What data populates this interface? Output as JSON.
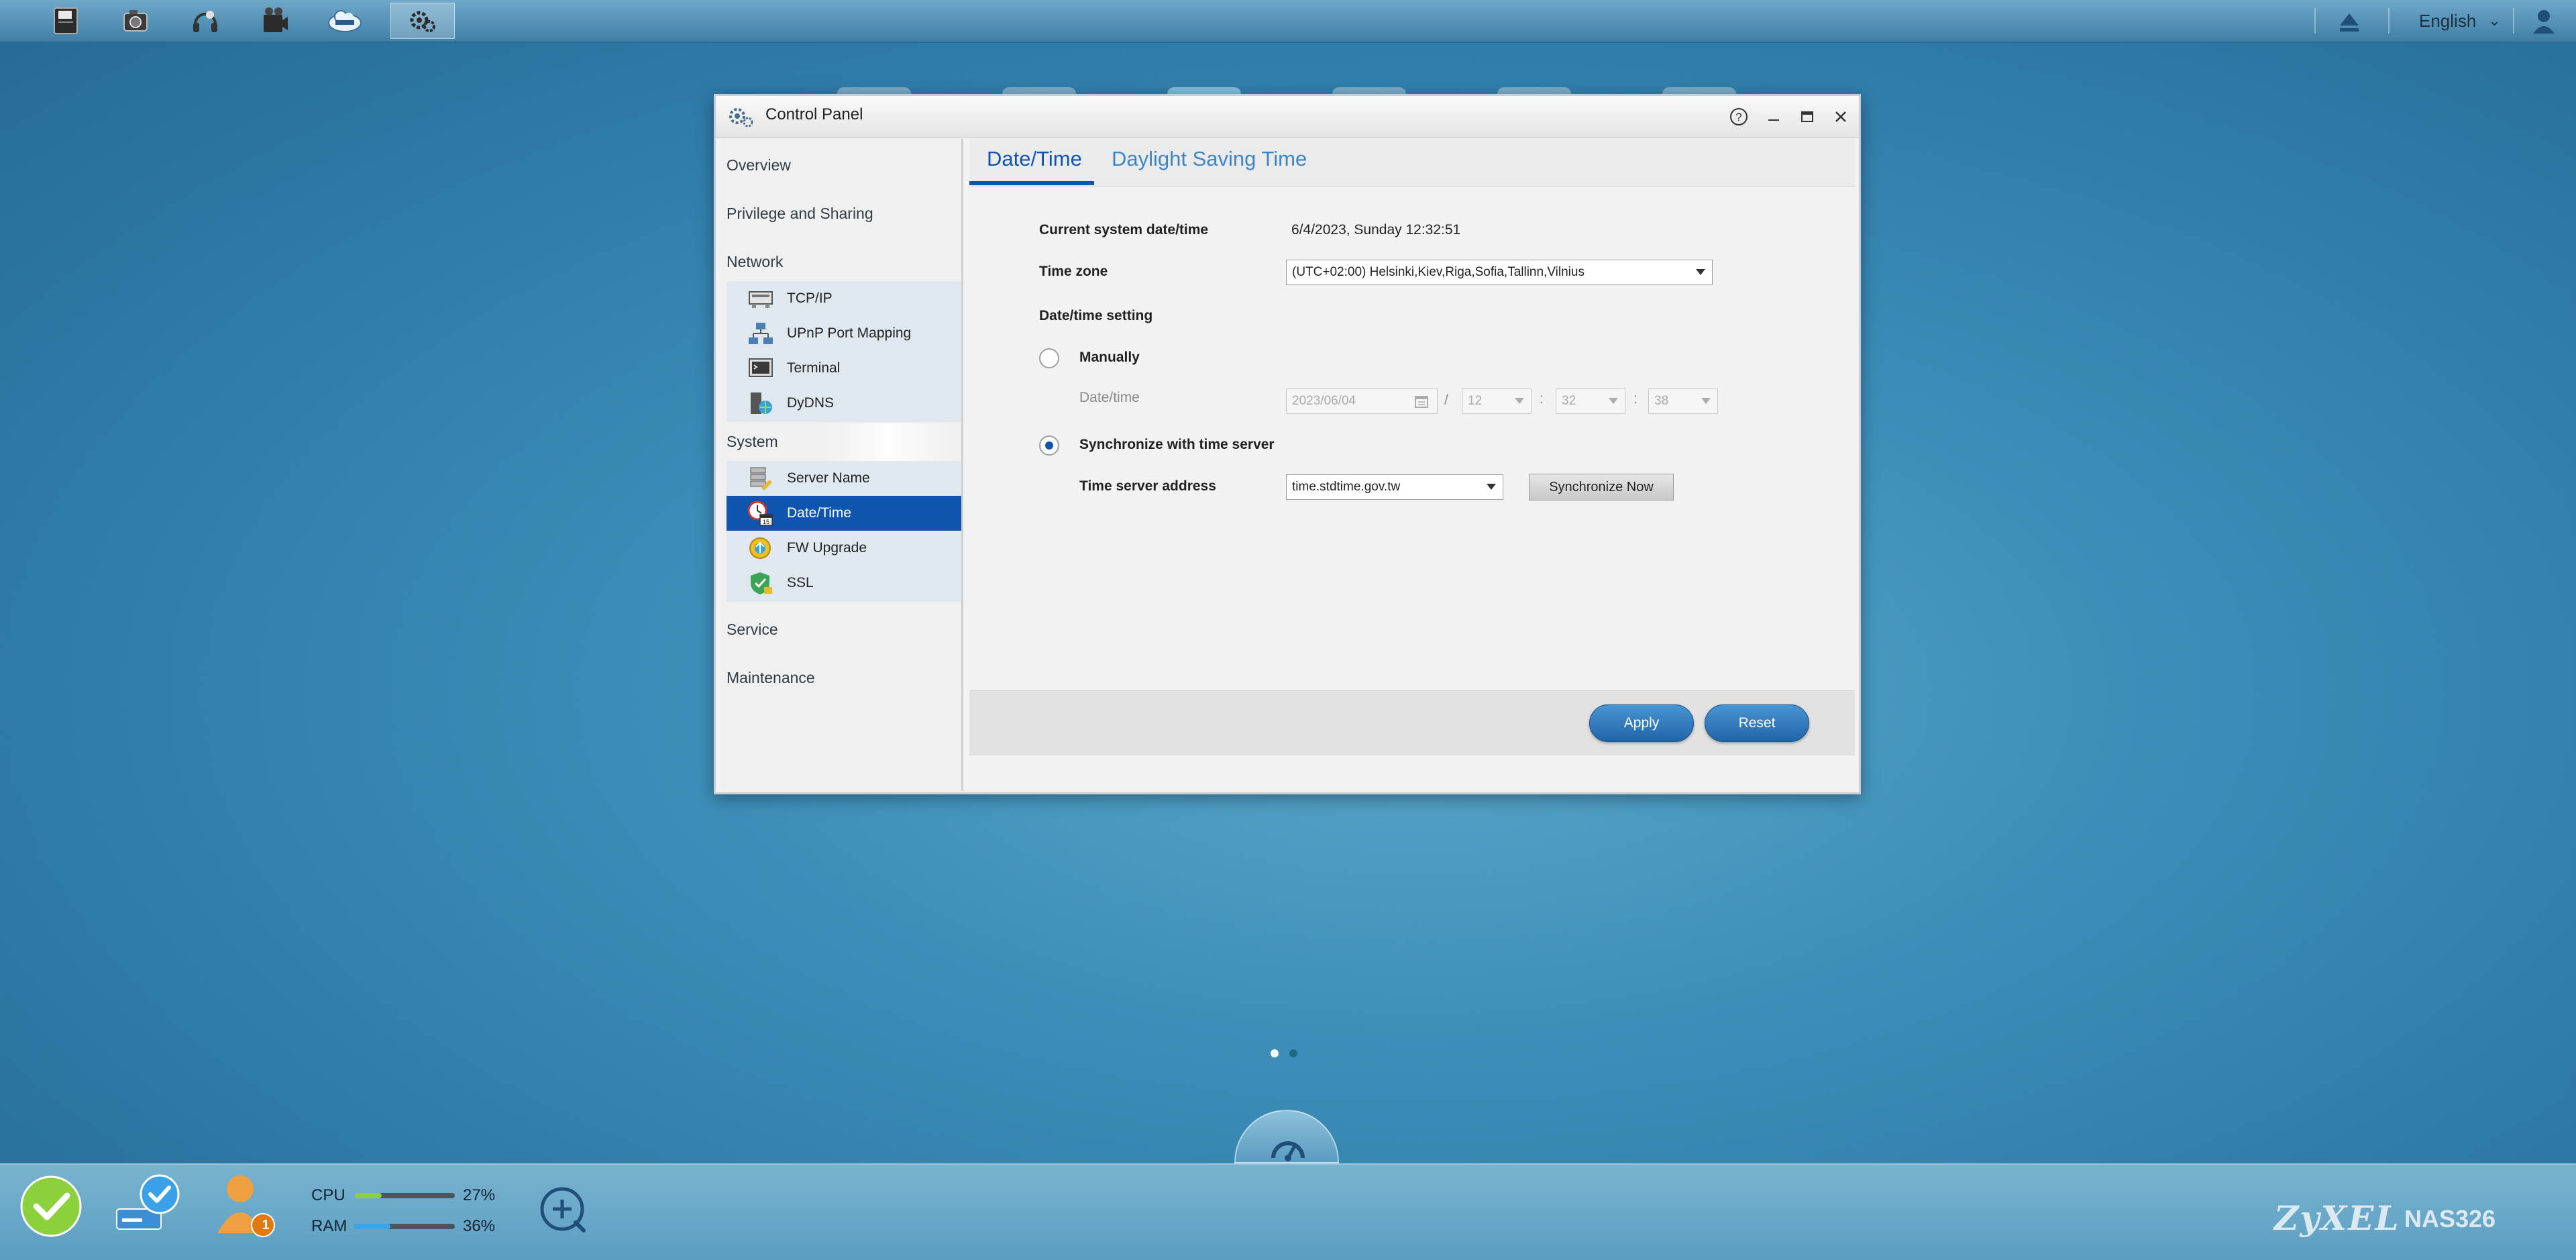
{
  "topbar": {
    "apps": [
      {
        "icon": "file-browser-icon"
      },
      {
        "icon": "photo-icon"
      },
      {
        "icon": "music-icon"
      },
      {
        "icon": "video-icon"
      },
      {
        "icon": "zyxel-cloud-icon"
      },
      {
        "icon": "control-panel-icon"
      }
    ],
    "language": "English"
  },
  "window": {
    "title": "Control Panel",
    "controls": [
      "help-icon",
      "minimize-icon",
      "maximize-icon",
      "close-icon"
    ]
  },
  "sidebar": {
    "overview": "Overview",
    "privilege": "Privilege and Sharing",
    "network": "Network",
    "network_items": [
      "TCP/IP",
      "UPnP Port Mapping",
      "Terminal",
      "DyDNS"
    ],
    "system": "System",
    "system_items": [
      "Server Name",
      "Date/Time",
      "FW Upgrade",
      "SSL"
    ],
    "service": "Service",
    "maintenance": "Maintenance"
  },
  "tabs": [
    "Date/Time",
    "Daylight Saving Time"
  ],
  "form": {
    "current_label": "Current system date/time",
    "current_value": "6/4/2023, Sunday 12:32:51",
    "timezone_label": "Time zone",
    "timezone_value": "(UTC+02:00) Helsinki,Kiev,Riga,Sofia,Tallinn,Vilnius",
    "setting_label": "Date/time setting",
    "manually_label": "Manually",
    "datetime_label": "Date/time",
    "date_value": "2023/06/04",
    "date_sep": "/",
    "time_sep1": ":",
    "time_sep2": ":",
    "hour_value": "12",
    "minute_value": "32",
    "second_value": "38",
    "sync_label": "Synchronize with time server",
    "server_label": "Time server address",
    "server_value": "time.stdtime.gov.tw",
    "sync_now": "Synchronize Now"
  },
  "footer": {
    "apply": "Apply",
    "reset": "Reset"
  },
  "status": {
    "cpu_label": "CPU",
    "cpu_value": "27%",
    "cpu_fraction": 0.27,
    "ram_label": "RAM",
    "ram_value": "36%",
    "ram_fraction": 0.36,
    "user_badge": "1",
    "brand": "ZyXEL",
    "model": "NAS326"
  },
  "colors": {
    "accent": "#0f55b0",
    "cpu_bar": "#8bd13b",
    "ram_bar": "#3aa6e8"
  }
}
